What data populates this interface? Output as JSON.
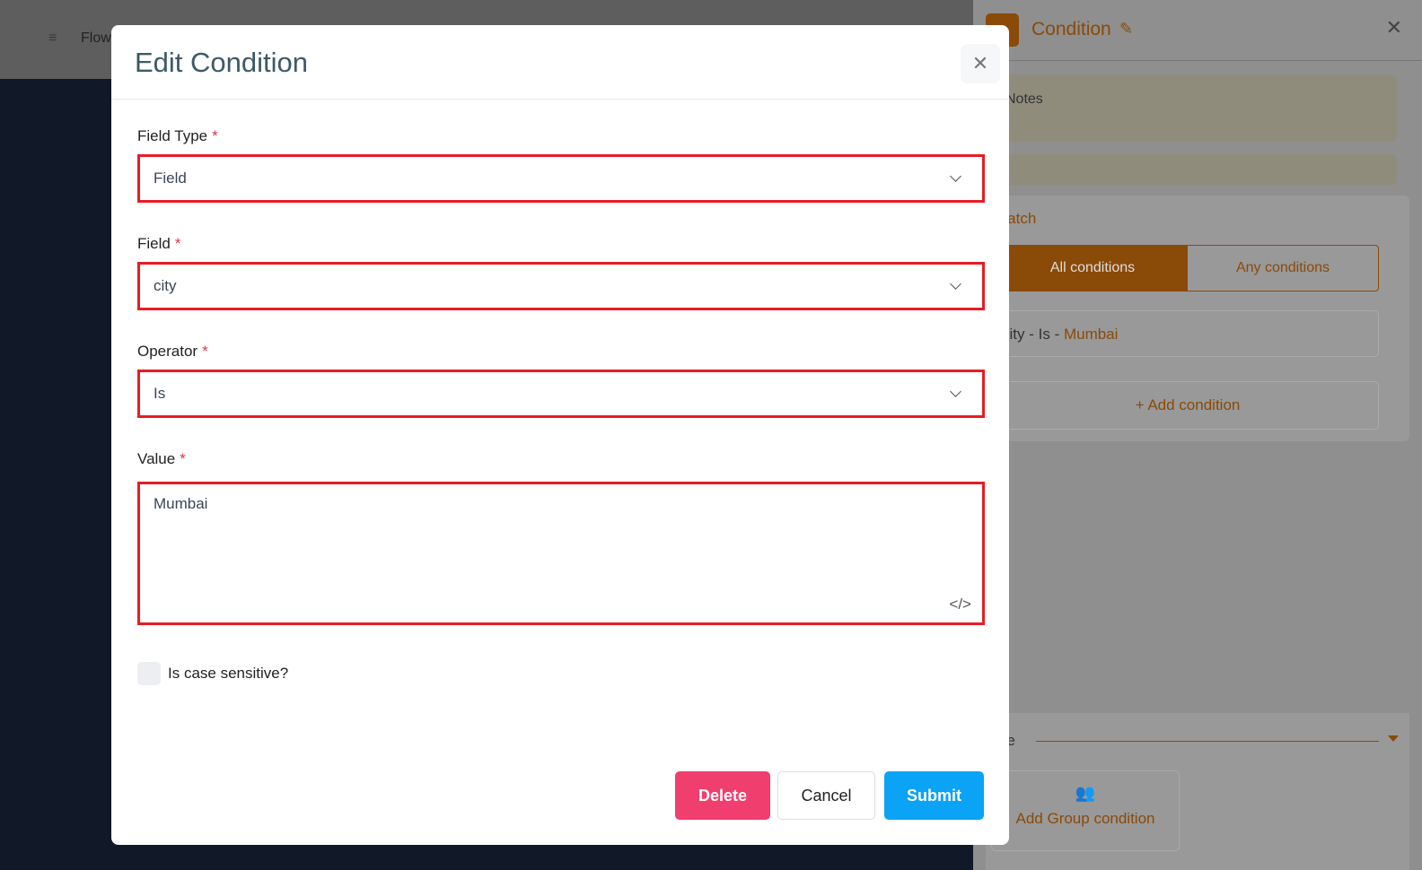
{
  "background": {
    "app_name": "Flow"
  },
  "right_panel": {
    "title": "Condition",
    "notes_placeholder": "Notes",
    "match_label": "match",
    "segments": [
      "All conditions",
      "Any conditions"
    ],
    "condition": {
      "field": "city",
      "sep1": " - ",
      "operator": "Is",
      "sep2": " - ",
      "value": "Mumbai"
    },
    "add_condition": "+ Add condition",
    "mode_label": "de",
    "add_group": "Add Group condition"
  },
  "modal": {
    "title": "Edit Condition",
    "field_type_label": "Field Type",
    "field_type_value": "Field",
    "field_label": "Field",
    "field_value": "city",
    "operator_label": "Operator",
    "operator_value": "Is",
    "value_label": "Value",
    "value_value": "Mumbai",
    "required_mark": "*",
    "case_sensitive_label": "Is case sensitive?",
    "case_sensitive": false,
    "delete": "Delete",
    "cancel": "Cancel",
    "submit": "Submit"
  },
  "colors": {
    "accent": "#8a4a08",
    "highlight": "#e81c24",
    "delete": "#f03e6e",
    "submit": "#0aa3f5"
  }
}
